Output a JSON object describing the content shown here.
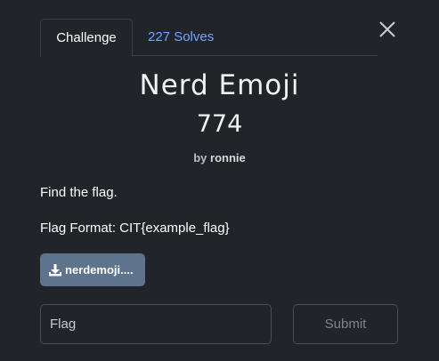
{
  "tabs": [
    {
      "label": "Challenge",
      "active": true
    },
    {
      "label": "227 Solves",
      "active": false
    }
  ],
  "challenge": {
    "name": "Nerd Emoji",
    "value": "774",
    "author_prefix": "by",
    "author": "ronnie",
    "description": [
      "Find the flag.",
      "Flag Format: CIT{example_flag}"
    ],
    "file_label": "nerdemoji...."
  },
  "form": {
    "flag_placeholder": "Flag",
    "submit_label": "Submit"
  },
  "icons": {
    "close": "close-icon",
    "download": "download-icon"
  },
  "colors": {
    "background": "#212529",
    "link": "#6ea8fe",
    "file_button": "#5e738c",
    "border": "#4a5058"
  }
}
